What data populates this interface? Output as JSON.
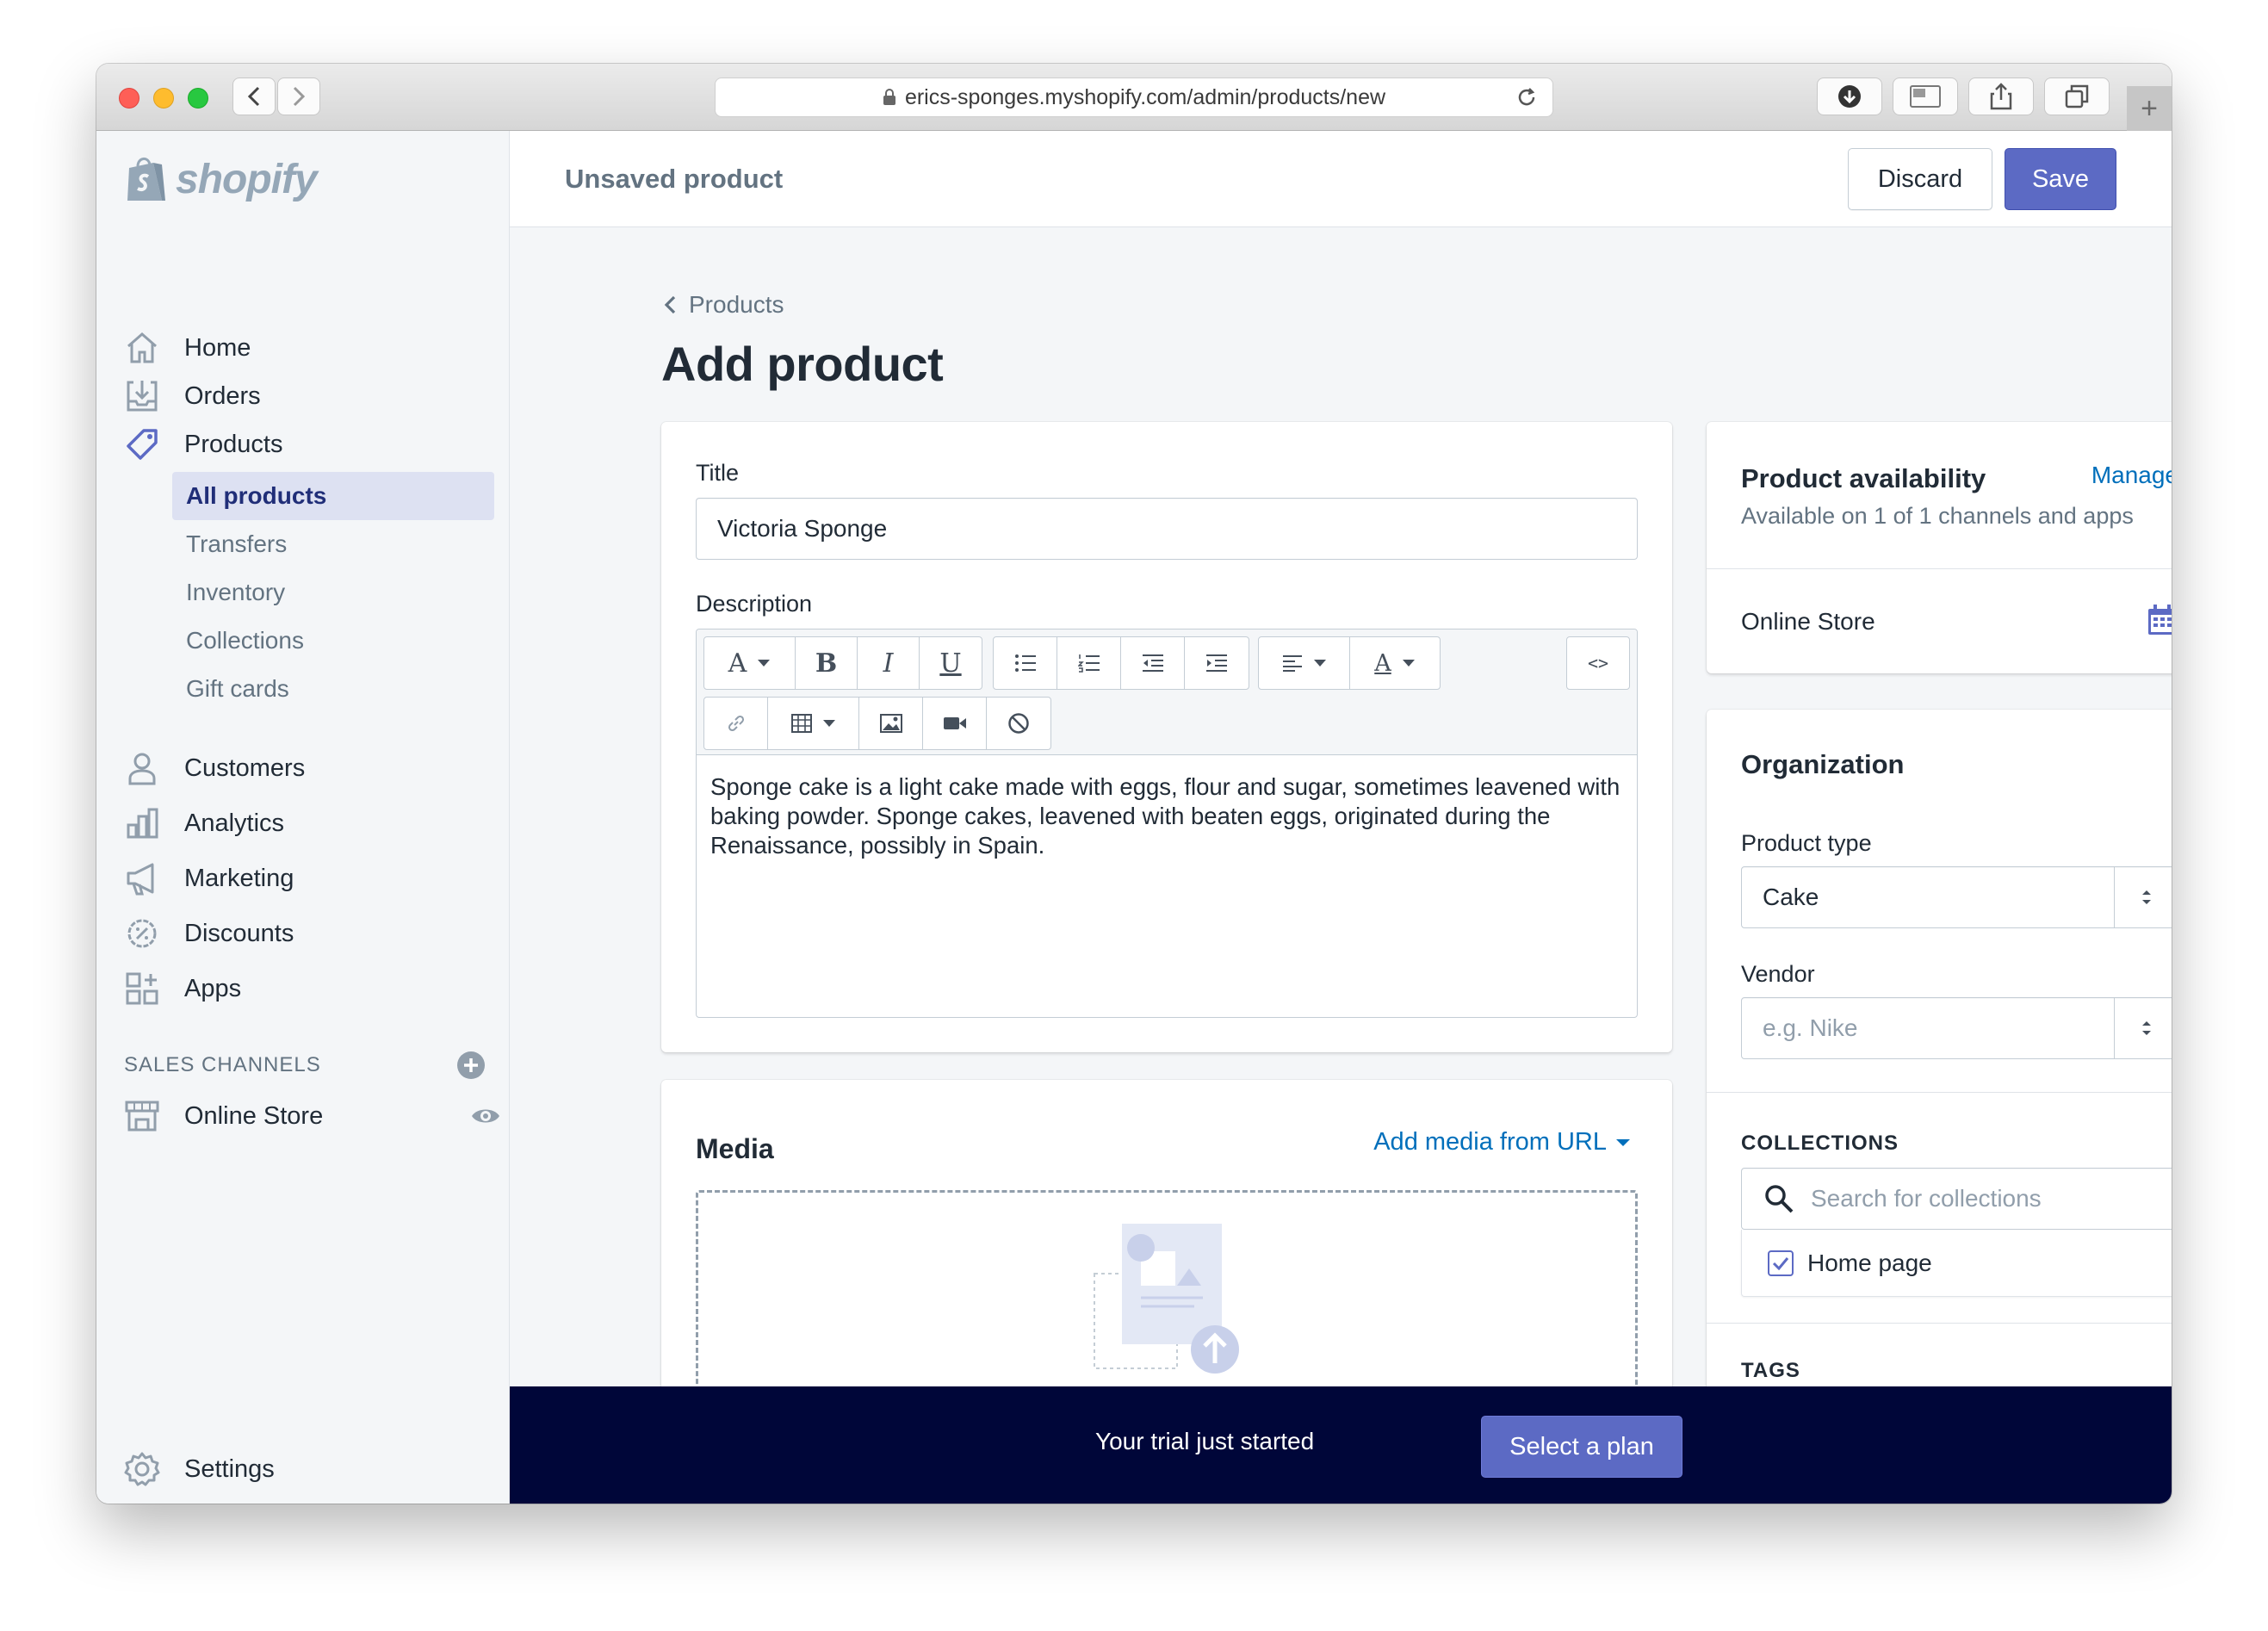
{
  "browser": {
    "url": "erics-sponges.myshopify.com/admin/products/new"
  },
  "brand": {
    "logo_text": "shopify",
    "accent": "#5c6ac4",
    "link_color": "#006fbb"
  },
  "header": {
    "title": "Unsaved product",
    "discard_label": "Discard",
    "save_label": "Save"
  },
  "sidebar": {
    "items": [
      {
        "label": "Home",
        "icon": "home-icon"
      },
      {
        "label": "Orders",
        "icon": "orders-icon"
      },
      {
        "label": "Products",
        "icon": "tag-icon"
      }
    ],
    "product_subitems": [
      "All products",
      "Transfers",
      "Inventory",
      "Collections",
      "Gift cards"
    ],
    "items_lower": [
      {
        "label": "Customers",
        "icon": "customer-icon"
      },
      {
        "label": "Analytics",
        "icon": "analytics-icon"
      },
      {
        "label": "Marketing",
        "icon": "marketing-icon"
      },
      {
        "label": "Discounts",
        "icon": "discount-icon"
      },
      {
        "label": "Apps",
        "icon": "apps-icon"
      }
    ],
    "sales_channels_header": "SALES CHANNELS",
    "online_store_label": "Online Store",
    "settings_label": "Settings"
  },
  "page": {
    "breadcrumb": "Products",
    "title": "Add product"
  },
  "product_form": {
    "title_label": "Title",
    "title_value": "Victoria Sponge",
    "description_label": "Description",
    "description_value": "Sponge cake is a light cake made with eggs, flour and sugar, sometimes leavened with baking powder. Sponge cakes, leavened with beaten eggs, originated during the Renaissance, possibly in Spain.",
    "toolbar_html_label": "<>"
  },
  "media": {
    "title": "Media",
    "add_from_url": "Add media from URL"
  },
  "availability": {
    "title": "Product availability",
    "manage_label": "Manage",
    "subtitle": "Available on 1 of 1 channels and apps",
    "channel": "Online Store"
  },
  "organization": {
    "title": "Organization",
    "product_type_label": "Product type",
    "product_type_value": "Cake",
    "vendor_label": "Vendor",
    "vendor_placeholder": "e.g. Nike",
    "collections_header": "COLLECTIONS",
    "collections_search_placeholder": "Search for collections",
    "collection_checked": "Home page",
    "tags_header": "TAGS"
  },
  "trial_banner": {
    "text": "Your trial just started",
    "button_label": "Select a plan"
  }
}
